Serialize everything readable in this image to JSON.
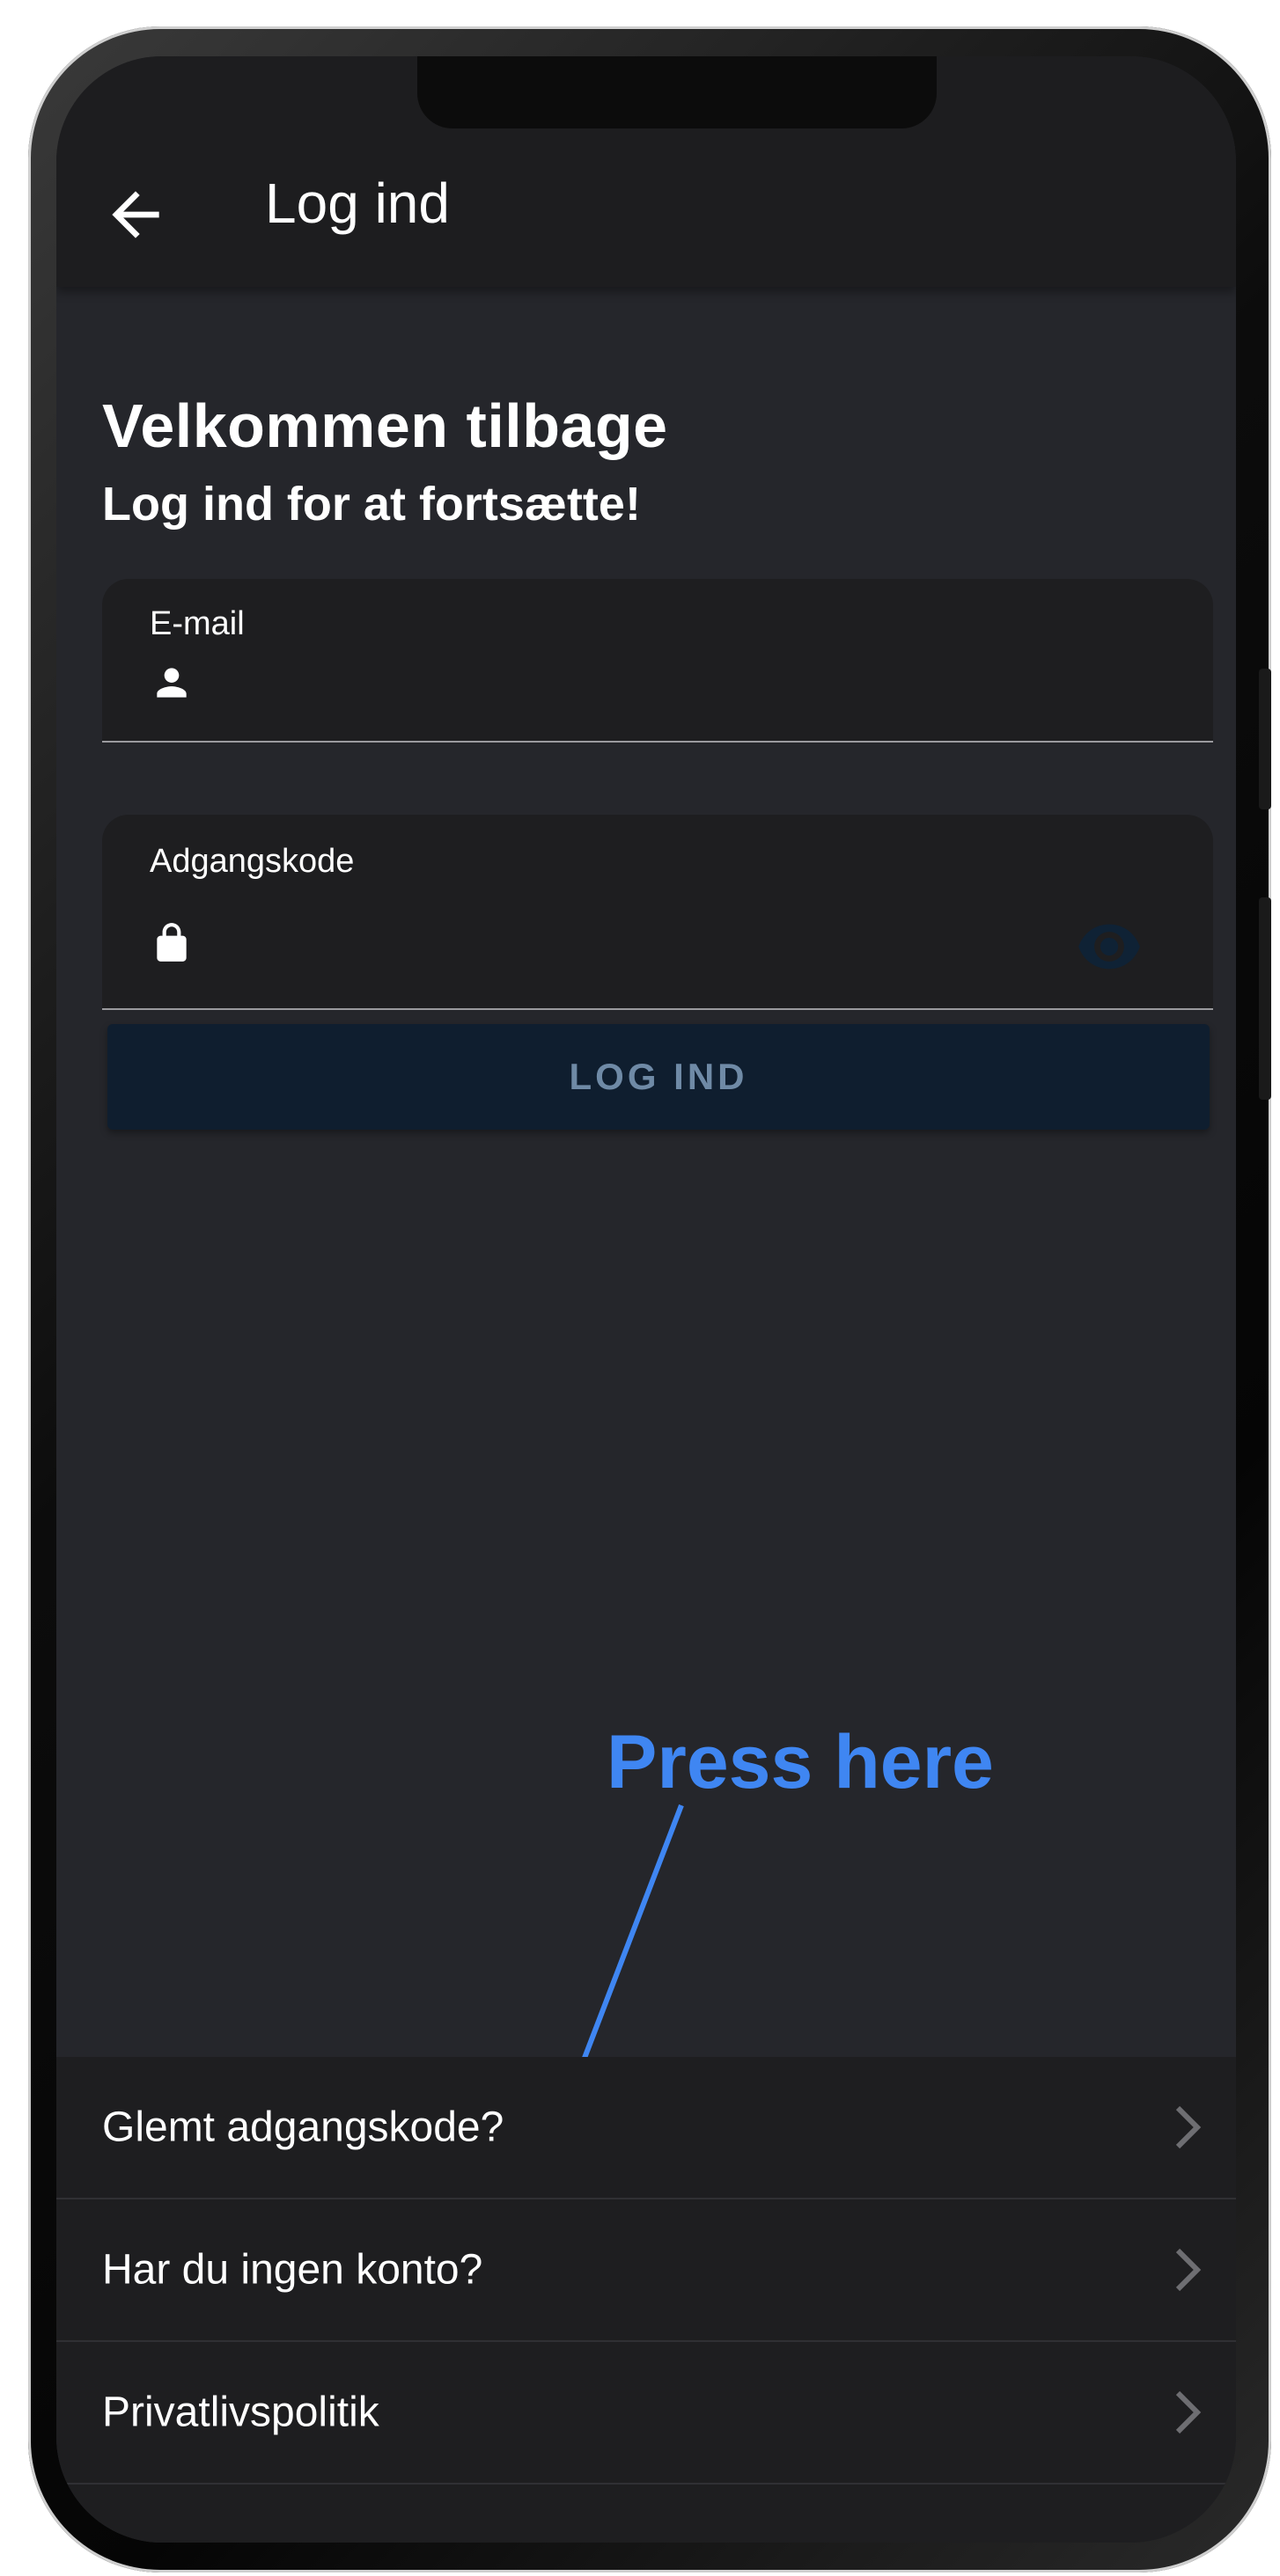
{
  "app_bar": {
    "back_icon": "arrow-left-icon",
    "title": "Log ind"
  },
  "header": {
    "welcome": "Velkommen tilbage",
    "subtitle": "Log ind for at fortsætte!"
  },
  "form": {
    "email": {
      "label": "E-mail",
      "value": "",
      "icon": "person-icon"
    },
    "password": {
      "label": "Adgangskode",
      "value": "",
      "icon": "lock-icon",
      "toggle_icon": "eye-icon"
    },
    "submit_label": "LOG IND"
  },
  "annotation": {
    "text": "Press here",
    "color": "#3f86f2"
  },
  "links": [
    {
      "label": "Glemt adgangskode?",
      "icon": "chevron-right-icon"
    },
    {
      "label": "Har du ingen konto?",
      "icon": "chevron-right-icon"
    },
    {
      "label": "Privatlivspolitik",
      "icon": "chevron-right-icon"
    }
  ],
  "colors": {
    "background": "#25262b",
    "surface": "#1e1e20",
    "app_bar": "#1d1d1f",
    "button_bg": "#0f1e2f",
    "button_text": "#6f8aa6",
    "accent": "#3f86f2"
  }
}
